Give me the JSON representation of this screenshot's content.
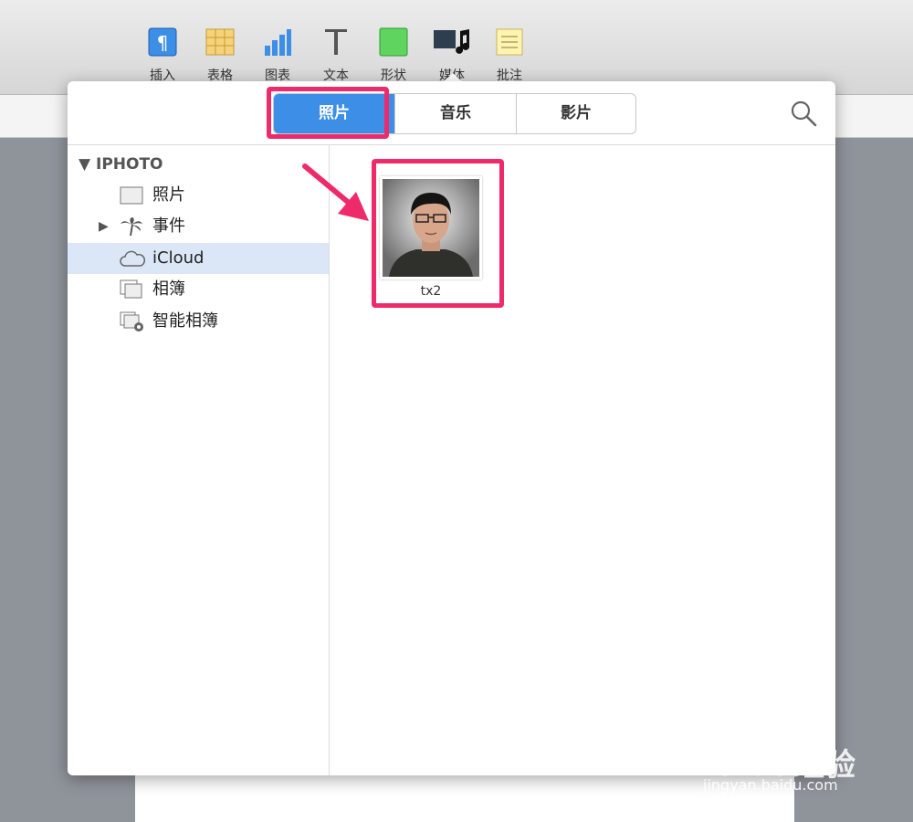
{
  "toolbar": {
    "items": [
      {
        "label": "插入",
        "icon": "paragraph-icon"
      },
      {
        "label": "表格",
        "icon": "table-icon"
      },
      {
        "label": "图表",
        "icon": "chart-icon"
      },
      {
        "label": "文本",
        "icon": "text-icon"
      },
      {
        "label": "形状",
        "icon": "shape-icon"
      },
      {
        "label": "媒体",
        "icon": "media-icon"
      },
      {
        "label": "批注",
        "icon": "comment-icon"
      }
    ]
  },
  "media_browser": {
    "tabs": [
      {
        "label": "照片",
        "selected": true
      },
      {
        "label": "音乐",
        "selected": false
      },
      {
        "label": "影片",
        "selected": false
      }
    ],
    "sidebar": {
      "section_title": "IPHOTO",
      "items": [
        {
          "label": "照片",
          "icon": "photos-icon",
          "selected": false
        },
        {
          "label": "事件",
          "icon": "palm-tree-icon",
          "selected": false
        },
        {
          "label": "iCloud",
          "icon": "cloud-icon",
          "selected": true
        },
        {
          "label": "相簿",
          "icon": "albums-icon",
          "selected": false
        },
        {
          "label": "智能相簿",
          "icon": "smart-album-icon",
          "selected": false
        }
      ]
    },
    "photos": [
      {
        "caption": "tx2"
      }
    ]
  },
  "watermark": {
    "brand": "Baidu经验",
    "url": "jingyan.baidu.com"
  },
  "colors": {
    "accent": "#3c8ee6",
    "highlight": "#ee2a6b",
    "selection": "#dbe7f6"
  }
}
